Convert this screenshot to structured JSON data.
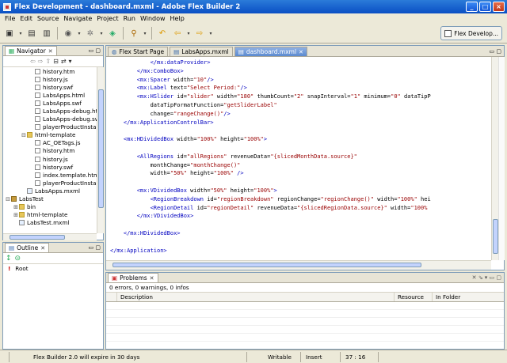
{
  "window": {
    "title": "Flex Development - dashboard.mxml - Adobe Flex Builder 2"
  },
  "menu": [
    "File",
    "Edit",
    "Source",
    "Navigate",
    "Project",
    "Run",
    "Window",
    "Help"
  ],
  "perspective": {
    "label": "Flex Develop..."
  },
  "navigator": {
    "title": "Navigator",
    "items": [
      {
        "label": "history.htm",
        "indent": 3,
        "type": "file"
      },
      {
        "label": "history.js",
        "indent": 3,
        "type": "file"
      },
      {
        "label": "history.swf",
        "indent": 3,
        "type": "file"
      },
      {
        "label": "LabsApps.html",
        "indent": 3,
        "type": "file"
      },
      {
        "label": "LabsApps.swf",
        "indent": 3,
        "type": "file"
      },
      {
        "label": "LabsApps-debug.htm",
        "indent": 3,
        "type": "file"
      },
      {
        "label": "LabsApps-debug.sw",
        "indent": 3,
        "type": "file"
      },
      {
        "label": "playerProductInstall",
        "indent": 3,
        "type": "file"
      },
      {
        "label": "html-template",
        "indent": 2,
        "type": "folder",
        "twisty": "−"
      },
      {
        "label": "AC_OETags.js",
        "indent": 3,
        "type": "file"
      },
      {
        "label": "history.htm",
        "indent": 3,
        "type": "file"
      },
      {
        "label": "history.js",
        "indent": 3,
        "type": "file"
      },
      {
        "label": "history.swf",
        "indent": 3,
        "type": "file"
      },
      {
        "label": "index.template.html",
        "indent": 3,
        "type": "file"
      },
      {
        "label": "playerProductInstall",
        "indent": 3,
        "type": "file"
      },
      {
        "label": "LabsApps.mxml",
        "indent": 2,
        "type": "mxml"
      },
      {
        "label": "LabsTest",
        "indent": 0,
        "type": "proj",
        "twisty": "−"
      },
      {
        "label": "bin",
        "indent": 1,
        "type": "folder",
        "twisty": "+"
      },
      {
        "label": "html-template",
        "indent": 1,
        "type": "folder",
        "twisty": "+"
      },
      {
        "label": "LabsTest.mxml",
        "indent": 1,
        "type": "mxml"
      }
    ]
  },
  "outline": {
    "title": "Outline",
    "root": "Root"
  },
  "editor": {
    "tabs": [
      {
        "label": "Flex Start Page",
        "active": false
      },
      {
        "label": "LabsApps.mxml",
        "active": false
      },
      {
        "label": "dashboard.mxml",
        "active": true
      }
    ],
    "lines": [
      [
        {
          "t": "            </mx:dataProvider>",
          "c": "tag"
        }
      ],
      [
        {
          "t": "        </mx:ComboBox>",
          "c": "tag"
        }
      ],
      [
        {
          "t": "        <mx:Spacer ",
          "c": "tag"
        },
        {
          "t": "width=",
          "c": "attr"
        },
        {
          "t": "\"10\"",
          "c": "str"
        },
        {
          "t": "/>",
          "c": "tag"
        }
      ],
      [
        {
          "t": "        <mx:Label ",
          "c": "tag"
        },
        {
          "t": "text=",
          "c": "attr"
        },
        {
          "t": "\"Select Period:\"",
          "c": "str"
        },
        {
          "t": "/>",
          "c": "tag"
        }
      ],
      [
        {
          "t": "        <mx:HSlider ",
          "c": "tag"
        },
        {
          "t": "id=",
          "c": "attr"
        },
        {
          "t": "\"slider\"",
          "c": "str"
        },
        {
          "t": " width=",
          "c": "attr"
        },
        {
          "t": "\"180\"",
          "c": "str"
        },
        {
          "t": " thumbCount=",
          "c": "attr"
        },
        {
          "t": "\"2\"",
          "c": "str"
        },
        {
          "t": " snapInterval=",
          "c": "attr"
        },
        {
          "t": "\"1\"",
          "c": "str"
        },
        {
          "t": " minimum=",
          "c": "attr"
        },
        {
          "t": "\"0\"",
          "c": "str"
        },
        {
          "t": " dataTipP",
          "c": "attr"
        }
      ],
      [
        {
          "t": "            dataTipFormatFunction=",
          "c": "attr"
        },
        {
          "t": "\"getSliderLabel\"",
          "c": "str"
        }
      ],
      [
        {
          "t": "            change=",
          "c": "attr"
        },
        {
          "t": "\"rangeChange()\"",
          "c": "str"
        },
        {
          "t": "/>",
          "c": "tag"
        }
      ],
      [
        {
          "t": "    </mx:ApplicationControlBar>",
          "c": "tag"
        }
      ],
      [
        {
          "t": "",
          "c": "attr"
        }
      ],
      [
        {
          "t": "    <mx:HDividedBox ",
          "c": "tag"
        },
        {
          "t": "width=",
          "c": "attr"
        },
        {
          "t": "\"100%\"",
          "c": "str"
        },
        {
          "t": " height=",
          "c": "attr"
        },
        {
          "t": "\"100%\"",
          "c": "str"
        },
        {
          "t": ">",
          "c": "tag"
        }
      ],
      [
        {
          "t": "",
          "c": "attr"
        }
      ],
      [
        {
          "t": "        <AllRegions ",
          "c": "tag"
        },
        {
          "t": "id=",
          "c": "attr"
        },
        {
          "t": "\"allRegions\"",
          "c": "str"
        },
        {
          "t": " revenueData=",
          "c": "attr"
        },
        {
          "t": "\"{slicedMonthData.source}\"",
          "c": "str"
        }
      ],
      [
        {
          "t": "            monthChange=",
          "c": "attr"
        },
        {
          "t": "\"monthChange()\"",
          "c": "str"
        }
      ],
      [
        {
          "t": "            width=",
          "c": "attr"
        },
        {
          "t": "\"50%\"",
          "c": "str"
        },
        {
          "t": " height=",
          "c": "attr"
        },
        {
          "t": "\"100%\"",
          "c": "str"
        },
        {
          "t": " />",
          "c": "tag"
        }
      ],
      [
        {
          "t": "",
          "c": "attr"
        }
      ],
      [
        {
          "t": "        <mx:VDividedBox ",
          "c": "tag"
        },
        {
          "t": "width=",
          "c": "attr"
        },
        {
          "t": "\"50%\"",
          "c": "str"
        },
        {
          "t": " height=",
          "c": "attr"
        },
        {
          "t": "\"100%\"",
          "c": "str"
        },
        {
          "t": ">",
          "c": "tag"
        }
      ],
      [
        {
          "t": "            <RegionBreakdown ",
          "c": "tag"
        },
        {
          "t": "id=",
          "c": "attr"
        },
        {
          "t": "\"regionBreakdown\"",
          "c": "str"
        },
        {
          "t": " regionChange=",
          "c": "attr"
        },
        {
          "t": "\"regionChange()\"",
          "c": "str"
        },
        {
          "t": " width=",
          "c": "attr"
        },
        {
          "t": "\"100%\"",
          "c": "str"
        },
        {
          "t": " hei",
          "c": "attr"
        }
      ],
      [
        {
          "t": "            <RegionDetail ",
          "c": "tag"
        },
        {
          "t": "id=",
          "c": "attr"
        },
        {
          "t": "\"regionDetail\"",
          "c": "str"
        },
        {
          "t": " revenueData=",
          "c": "attr"
        },
        {
          "t": "\"{slicedRegionData.source}\"",
          "c": "str"
        },
        {
          "t": " width=",
          "c": "attr"
        },
        {
          "t": "\"100%",
          "c": "str"
        }
      ],
      [
        {
          "t": "        </mx:VDividedBox>",
          "c": "tag"
        }
      ],
      [
        {
          "t": "",
          "c": "attr"
        }
      ],
      [
        {
          "t": "    </mx:HDividedBox>",
          "c": "tag"
        }
      ],
      [
        {
          "t": "",
          "c": "attr"
        }
      ],
      [
        {
          "t": "</mx:Application>",
          "c": "tag"
        }
      ]
    ]
  },
  "problems": {
    "title": "Problems",
    "summary": "0 errors, 0 warnings, 0 infos",
    "columns": [
      "Description",
      "Resource",
      "In Folder"
    ]
  },
  "status": {
    "message": "Flex Builder 2.0 will expire in 30 days",
    "writable": "Writable",
    "insert": "Insert",
    "position": "37 : 16"
  },
  "colors": {
    "tag": "#0000c0",
    "attr": "#000000",
    "str": "#990000"
  }
}
